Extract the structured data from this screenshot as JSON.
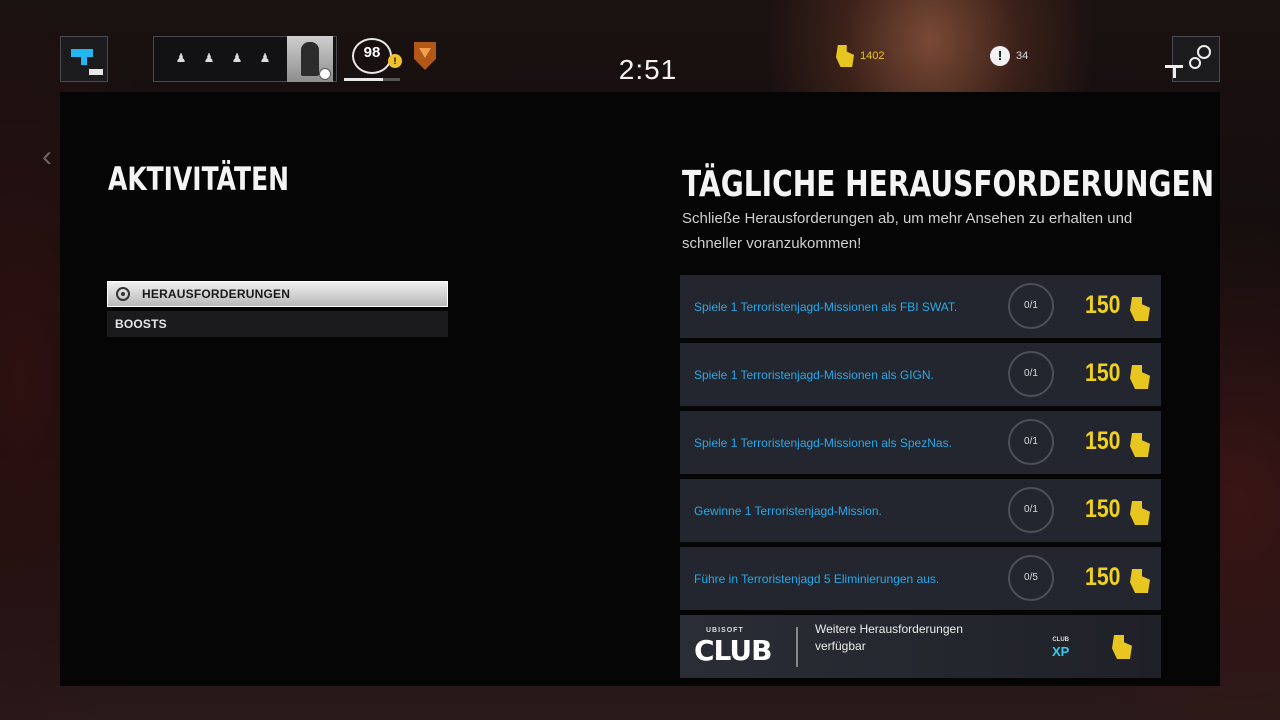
{
  "topbar": {
    "timer": "2:51",
    "level": "98",
    "level_progress": 0.7,
    "renown": "1402",
    "rp": "34",
    "squad_slots": [
      "player-slot",
      "player-slot",
      "player-slot",
      "player-slot"
    ],
    "icons": {
      "home": "pistol-icon",
      "rank": "rank-shield-icon",
      "renown": "renown-icon",
      "rp": "r6-credits-icon",
      "settings": "settings-gear-icon"
    }
  },
  "activities": {
    "title": "AKTIVITÄTEN",
    "menu": [
      {
        "label": "HERAUSFORDERUNGEN",
        "active": true
      },
      {
        "label": "BOOSTS",
        "active": false
      }
    ]
  },
  "daily": {
    "title": "TÄGLICHE HERAUSFORDERUNGEN",
    "subtitle": "Schließe Herausforderungen ab, um mehr Ansehen zu erhalten und schneller voranzukommen!",
    "challenges": [
      {
        "text": "Spiele 1 Terroristenjagd-Missionen als FBI SWAT.",
        "progress": "0/1",
        "reward": "150"
      },
      {
        "text": "Spiele 1 Terroristenjagd-Missionen als GIGN.",
        "progress": "0/1",
        "reward": "150"
      },
      {
        "text": "Spiele 1 Terroristenjagd-Missionen als SpezNas.",
        "progress": "0/1",
        "reward": "150"
      },
      {
        "text": "Gewinne 1 Terroristenjagd-Mission.",
        "progress": "0/1",
        "reward": "150"
      },
      {
        "text": "Führe in Terroristenjagd 5 Eliminierungen aus.",
        "progress": "0/5",
        "reward": "150"
      }
    ],
    "club": {
      "small_label": "UBISOFT",
      "logo": "CLUB",
      "text": "Weitere Herausforderungen verfügbar",
      "xp_small": "CLUB",
      "xp": "XP"
    }
  },
  "colors": {
    "accent_blue": "#2aa8e6",
    "renown_yellow": "#f0d21c",
    "panel_bg": "#050505",
    "row_bg": "#24262f"
  }
}
